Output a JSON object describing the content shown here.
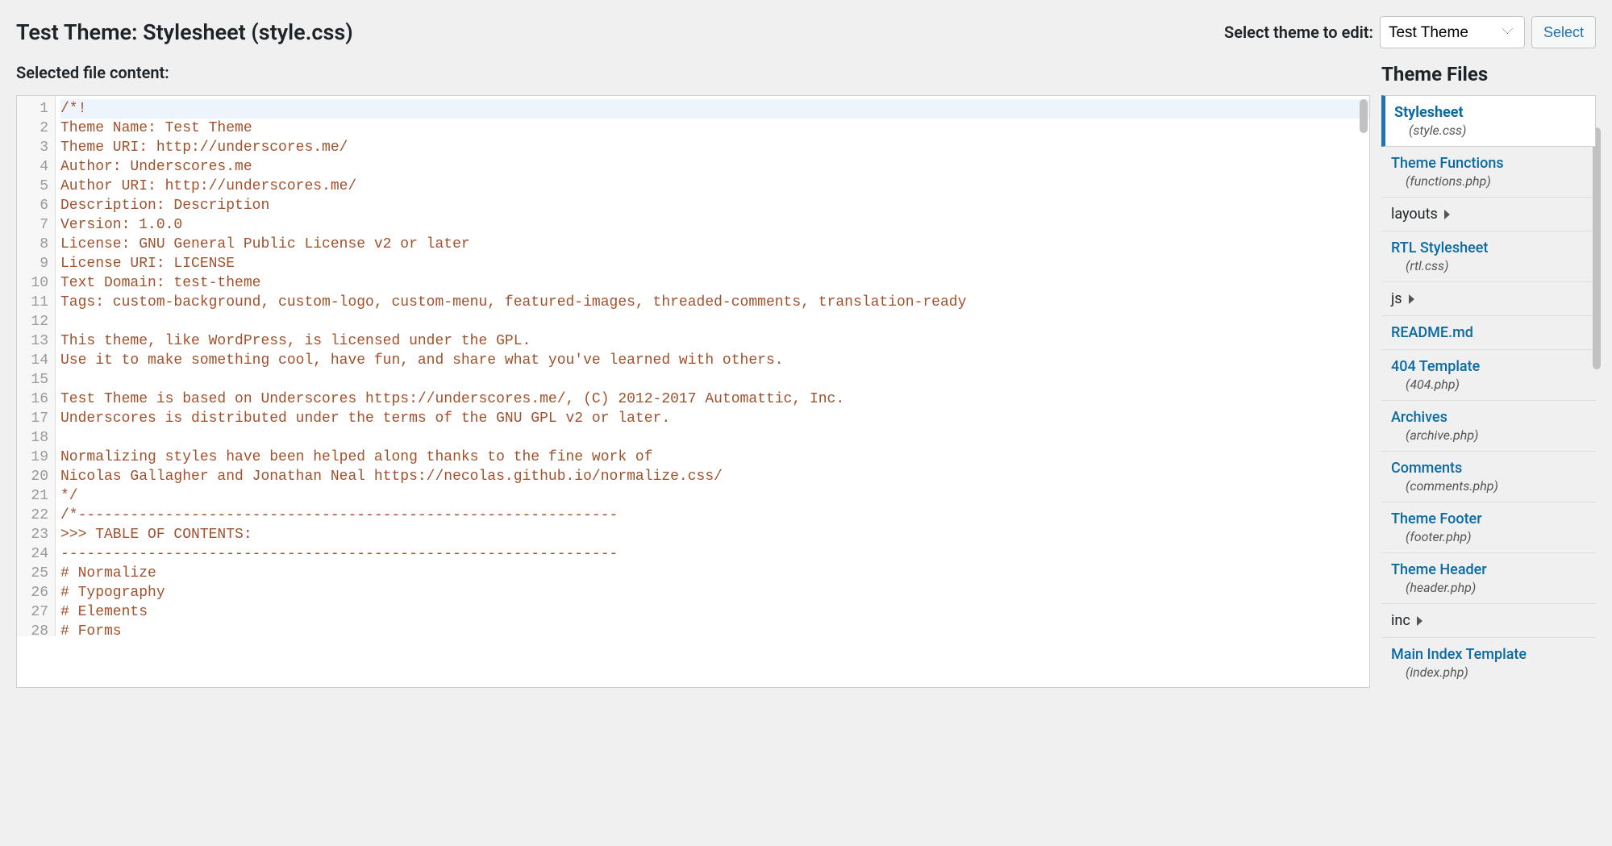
{
  "header": {
    "title": "Test Theme: Stylesheet (style.css)",
    "select_label": "Select theme to edit:",
    "select_value": "Test Theme",
    "select_button": "Select"
  },
  "subheader": "Selected file content:",
  "editor": {
    "lines": [
      "/*!",
      "Theme Name: Test Theme",
      "Theme URI: http://underscores.me/",
      "Author: Underscores.me",
      "Author URI: http://underscores.me/",
      "Description: Description",
      "Version: 1.0.0",
      "License: GNU General Public License v2 or later",
      "License URI: LICENSE",
      "Text Domain: test-theme",
      "Tags: custom-background, custom-logo, custom-menu, featured-images, threaded-comments, translation-ready",
      "",
      "This theme, like WordPress, is licensed under the GPL.",
      "Use it to make something cool, have fun, and share what you've learned with others.",
      "",
      "Test Theme is based on Underscores https://underscores.me/, (C) 2012-2017 Automattic, Inc.",
      "Underscores is distributed under the terms of the GNU GPL v2 or later.",
      "",
      "Normalizing styles have been helped along thanks to the fine work of",
      "Nicolas Gallagher and Jonathan Neal https://necolas.github.io/normalize.css/",
      "*/",
      "/*--------------------------------------------------------------",
      ">>> TABLE OF CONTENTS:",
      "----------------------------------------------------------------",
      "# Normalize",
      "# Typography",
      "# Elements",
      "# Forms"
    ]
  },
  "sidebar": {
    "title": "Theme Files",
    "files": [
      {
        "type": "file",
        "name": "Stylesheet",
        "sub": "(style.css)",
        "active": true
      },
      {
        "type": "file",
        "name": "Theme Functions",
        "sub": "(functions.php)"
      },
      {
        "type": "folder",
        "name": "layouts"
      },
      {
        "type": "file",
        "name": "RTL Stylesheet",
        "sub": "(rtl.css)"
      },
      {
        "type": "folder",
        "name": "js"
      },
      {
        "type": "file",
        "name": "README.md"
      },
      {
        "type": "file",
        "name": "404 Template",
        "sub": "(404.php)"
      },
      {
        "type": "file",
        "name": "Archives",
        "sub": "(archive.php)"
      },
      {
        "type": "file",
        "name": "Comments",
        "sub": "(comments.php)"
      },
      {
        "type": "file",
        "name": "Theme Footer",
        "sub": "(footer.php)"
      },
      {
        "type": "file",
        "name": "Theme Header",
        "sub": "(header.php)"
      },
      {
        "type": "folder",
        "name": "inc"
      },
      {
        "type": "file",
        "name": "Main Index Template",
        "sub": "(index.php)"
      }
    ]
  }
}
